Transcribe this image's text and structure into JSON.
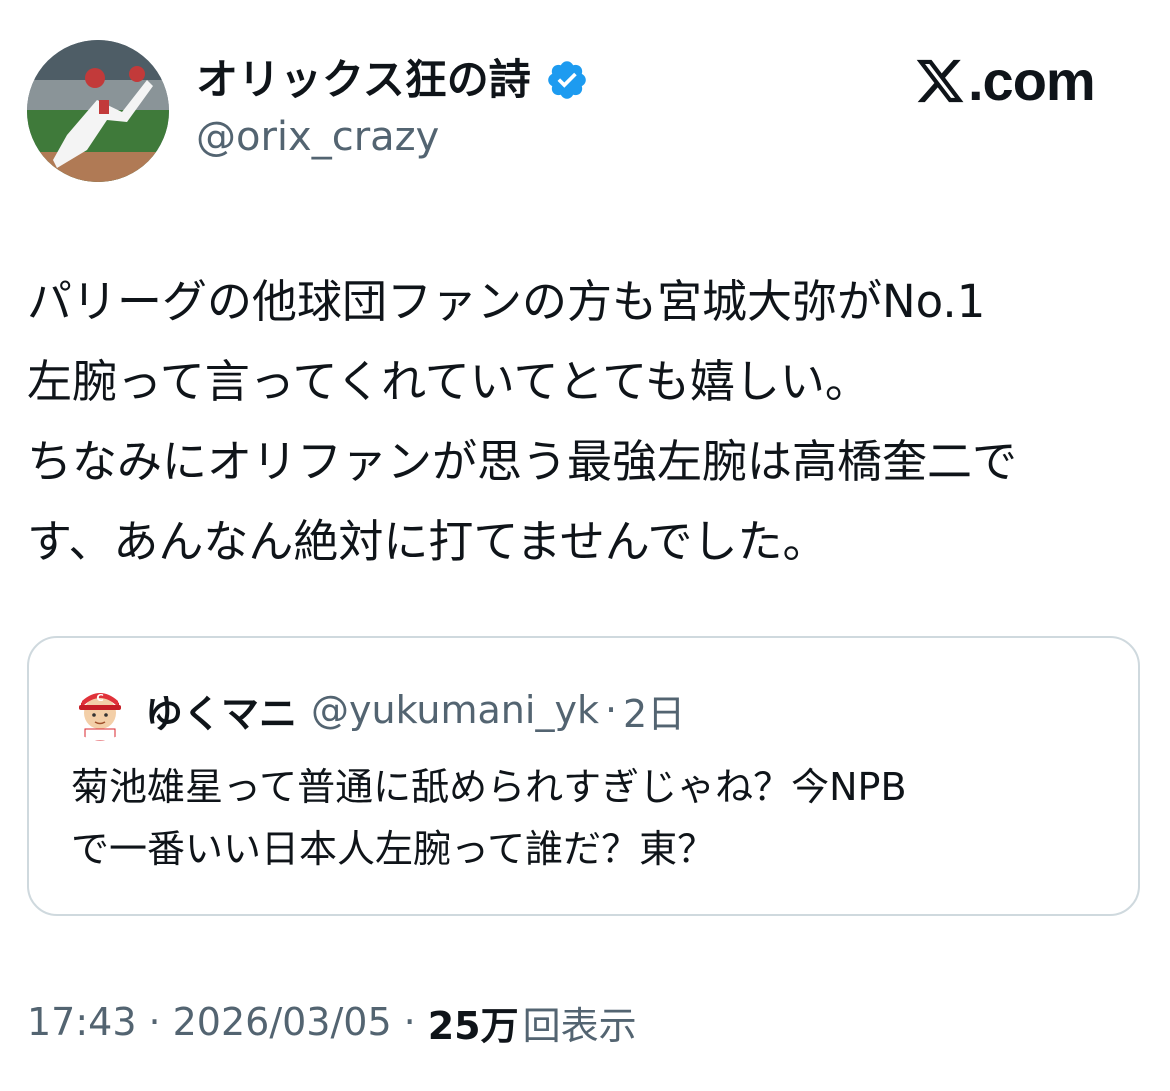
{
  "author": {
    "display_name": "オリックス狂の詩",
    "handle": "@orix_crazy",
    "verified": true,
    "badge_color": "#1d9bf0",
    "avatar_icon": "pitcher-photo-avatar"
  },
  "brand": {
    "domain": ".com",
    "logo_icon": "x-logo-icon"
  },
  "tweet": {
    "lines": [
      "パリーグの他球団ファンの方も宮城大弥がNo.1",
      "左腕って言ってくれていてとても嬉しい。",
      "ちなみにオリファンが思う最強左腕は高橋奎二で",
      "す、あんなん絶対に打てませんでした。"
    ]
  },
  "quote": {
    "avatar_icon": "carp-mascot-avatar",
    "display_name": "ゆくマニ",
    "handle": "@yukumani_yk",
    "separator": "·",
    "time": "2日",
    "lines": [
      "菊池雄星って普通に舐められすぎじゃね？今NPB",
      "で一番いい日本人左腕って誰だ？東？"
    ]
  },
  "meta": {
    "time": "17:43",
    "separator": "·",
    "date": "2026/03/05",
    "views_count": "25万",
    "views_label": "回表示"
  }
}
